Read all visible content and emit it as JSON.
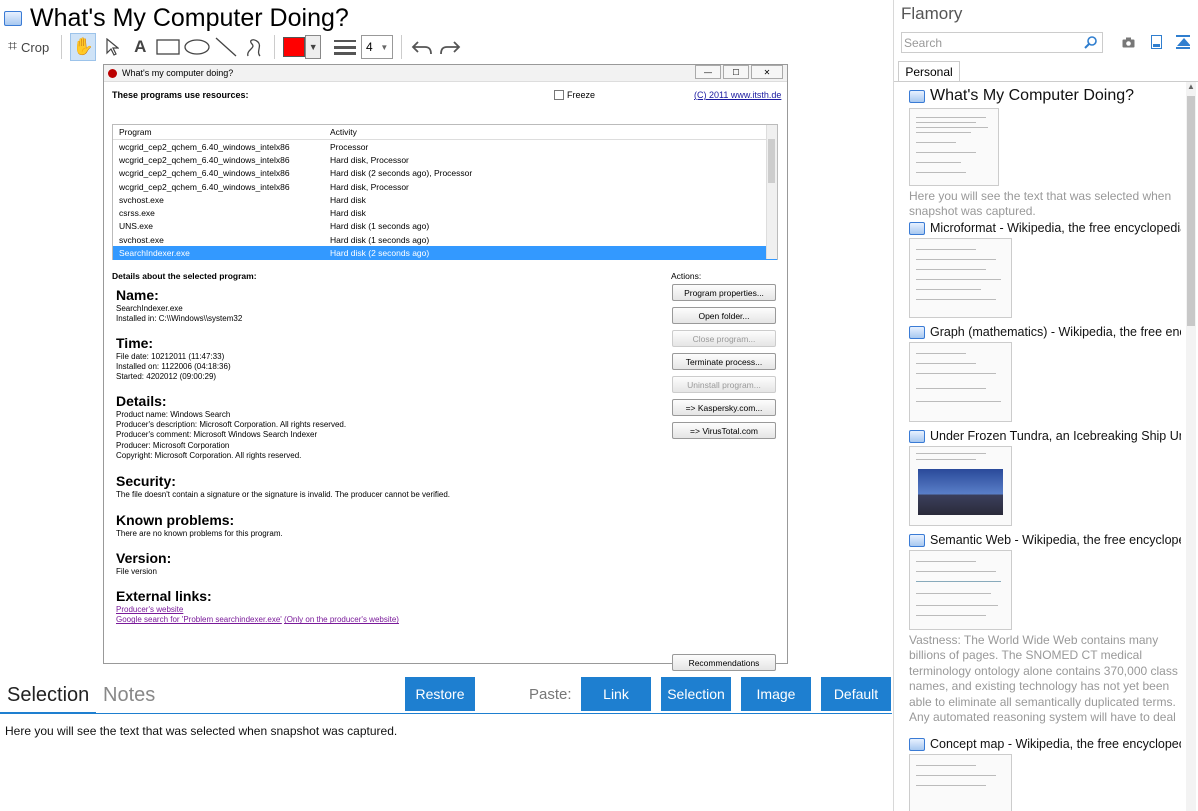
{
  "header": {
    "title": "What's My Computer Doing?"
  },
  "toolbar": {
    "crop_label": "Crop",
    "line_size": "4",
    "color": "#ff0000"
  },
  "screenshot": {
    "window_title": "What's my computer doing?",
    "resources_title": "These programs use resources:",
    "freeze_label": "Freeze",
    "copyright": "(C) 2011 www.itsth.de",
    "columns": [
      "Program",
      "Activity"
    ],
    "rows": [
      {
        "program": "wcgrid_cep2_qchem_6.40_windows_intelx86",
        "activity": "Processor"
      },
      {
        "program": "wcgrid_cep2_qchem_6.40_windows_intelx86",
        "activity": "Hard disk, Processor"
      },
      {
        "program": "wcgrid_cep2_qchem_6.40_windows_intelx86",
        "activity": "Hard disk (2 seconds ago), Processor"
      },
      {
        "program": "wcgrid_cep2_qchem_6.40_windows_intelx86",
        "activity": "Hard disk, Processor"
      },
      {
        "program": "svchost.exe",
        "activity": "Hard disk"
      },
      {
        "program": "csrss.exe",
        "activity": "Hard disk"
      },
      {
        "program": "UNS.exe",
        "activity": "Hard disk (1 seconds ago)"
      },
      {
        "program": "svchost.exe",
        "activity": "Hard disk (1 seconds ago)"
      },
      {
        "program": "SearchIndexer.exe",
        "activity": "Hard disk (2 seconds ago)"
      }
    ],
    "details_label": "Details about the selected program:",
    "actions_label": "Actions:",
    "actions": [
      "Program properties...",
      "Open folder...",
      "Close program...",
      "Terminate process...",
      "Uninstall program...",
      "=> Kaspersky.com...",
      "=> VirusTotal.com"
    ],
    "recommendations": "Recommendations",
    "name_h": "Name:",
    "name_lines": [
      "SearchIndexer.exe",
      "Installed in: C:\\\\Windows\\\\system32"
    ],
    "time_h": "Time:",
    "time_lines": [
      "File date: 10212011 (11:47:33)",
      "Installed on: 1122006 (04:18:36)",
      "Started: 4202012 (09:00:29)"
    ],
    "details_h": "Details:",
    "details_lines": [
      "Product name: Windows Search",
      "Producer's description: Microsoft Corporation. All rights reserved.",
      "Producer's comment: Microsoft Windows Search Indexer",
      "Producer: Microsoft Corporation",
      "Copyright: Microsoft Corporation. All rights reserved."
    ],
    "security_h": "Security:",
    "security_line": "The file doesn't contain a signature or the signature is invalid. The producer cannot be verified.",
    "known_h": "Known problems:",
    "known_line": "There are no known problems for this program.",
    "version_h": "Version:",
    "version_line": "File version",
    "links_h": "External links:",
    "link_producer": "Producer's website",
    "link_google": "Google search for 'Problem searchindexer.exe'",
    "link_only": "(Only on the producer's website)"
  },
  "bottom": {
    "tab_selection": "Selection",
    "tab_notes": "Notes",
    "restore": "Restore",
    "paste_label": "Paste:",
    "paste_link": "Link",
    "paste_selection": "Selection",
    "paste_image": "Image",
    "paste_default": "Default",
    "selection_text": "Here you will see the text that was selected when snapshot was captured."
  },
  "sidebar": {
    "brand": "Flamory",
    "search_placeholder": "Search",
    "tab": "Personal",
    "entries": [
      {
        "title": "What's My Computer Doing?",
        "desc": "Here you will see the text that was selected when snapshot was captured."
      },
      {
        "title": "Microformat - Wikipedia, the free encyclopedia",
        "desc": ""
      },
      {
        "title": "Graph (mathematics) - Wikipedia, the free encyclopedia",
        "desc": ""
      },
      {
        "title": "Under Frozen Tundra, an Icebreaking Ship Uncovers",
        "desc": ""
      },
      {
        "title": "Semantic Web - Wikipedia, the free encyclopedia",
        "desc": "Vastness: The World Wide Web contains many billions of pages. The SNOMED CT medical terminology ontology alone contains 370,000 class names, and existing technology has not yet been able to eliminate all semantically duplicated terms. Any automated reasoning system will have to deal with truly huge inputs."
      },
      {
        "title": "Concept map - Wikipedia, the free encyclopedia",
        "desc": ""
      }
    ]
  }
}
